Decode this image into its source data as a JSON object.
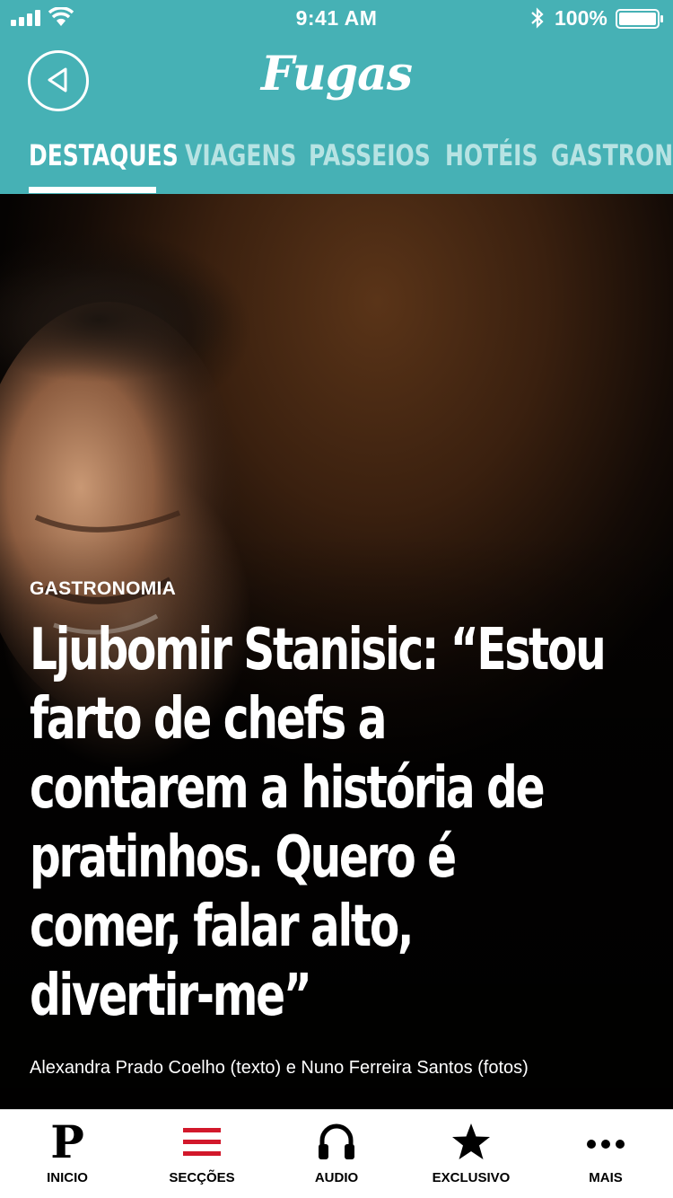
{
  "status_bar": {
    "time": "9:41 AM",
    "battery": "100%"
  },
  "header": {
    "logo": "Fugas",
    "back_icon": "back-arrow-icon",
    "background_color": "#46b1b5"
  },
  "tabs": [
    {
      "label": "DESTAQUES",
      "active": true
    },
    {
      "label": "VIAGENS",
      "active": false
    },
    {
      "label": "PASSEIOS",
      "active": false
    },
    {
      "label": "HOTÉIS",
      "active": false
    },
    {
      "label": "GASTRONOMIA",
      "active": false
    }
  ],
  "article": {
    "category": "GASTRONOMIA",
    "title_lines": [
      "Ljubomir Stanisic: “Estou",
      "farto de chefs a",
      "contarem a história de",
      "pratinhos. Quero é",
      "comer, falar alto,",
      "divertir-me”"
    ],
    "authors": "Alexandra Prado Coelho (texto) e Nuno Ferreira Santos (fotos)"
  },
  "bottom_nav": [
    {
      "label": "INICIO",
      "icon": "publico-p-icon"
    },
    {
      "label": "SECÇÕES",
      "icon": "menu-lines-icon",
      "accent": "#d2182b"
    },
    {
      "label": "AUDIO",
      "icon": "headphones-icon"
    },
    {
      "label": "EXCLUSIVO",
      "icon": "star-icon"
    },
    {
      "label": "MAIS",
      "icon": "more-dots-icon"
    }
  ]
}
